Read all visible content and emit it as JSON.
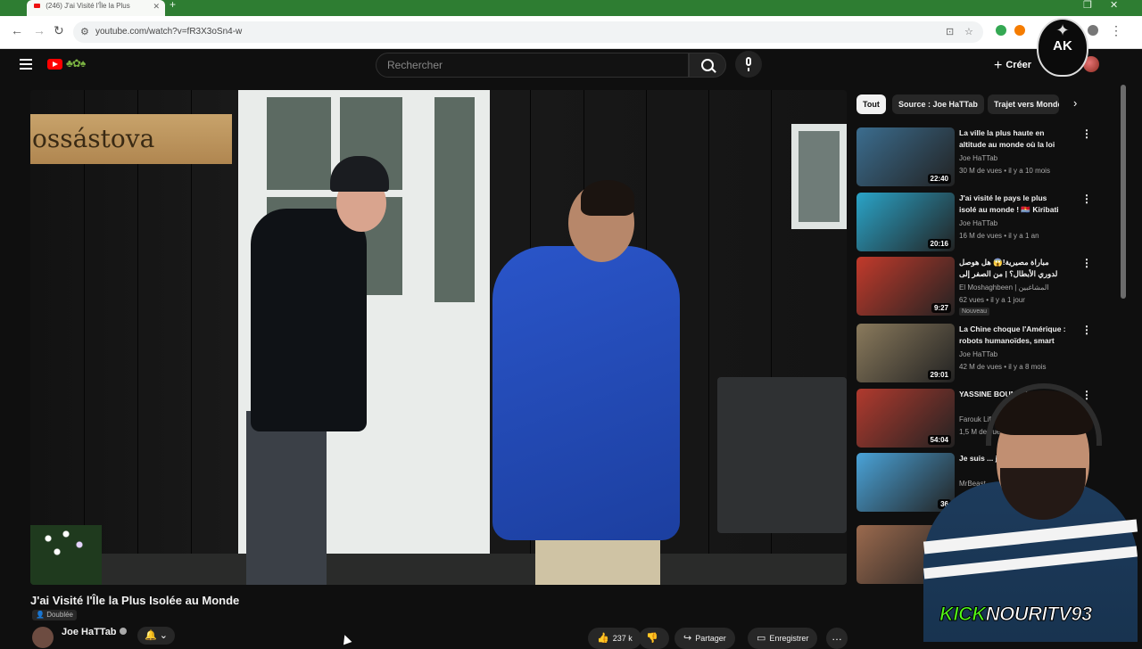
{
  "browser": {
    "tab_title": "(246) J'ai Visité l'Île la Plus",
    "url": "youtube.com/watch?v=fR3X3oSn4-w"
  },
  "overlay": {
    "logo_text": "AK",
    "kick_brand": "KICK",
    "kick_channel": "NOURITV93"
  },
  "header": {
    "search_placeholder": "Rechercher",
    "create_label": "Créer"
  },
  "video": {
    "sign_text": "ossástova",
    "title": "J'ai Visité l'Île la Plus Isolée au Monde",
    "dubbed_label": "Doublée",
    "channel": "Joe HaTTab",
    "likes": "237 k",
    "share_label": "Partager",
    "save_label": "Enregistrer"
  },
  "chips": [
    "Tout",
    "Source : Joe HaTTab",
    "Trajet vers Monde"
  ],
  "recommendations": [
    {
      "title": "La ville la plus haute en altitude au monde où la loi n'existe pas...",
      "channel": "Joe HaTTab",
      "meta": "30 M de vues • il y a 10 mois",
      "duration": "22:40",
      "thumb_color": "#3b6d8f"
    },
    {
      "title": "J'ai visité le pays le plus isolé au monde ! 🇰🇮 Kiribati",
      "channel": "Joe HaTTab",
      "meta": "16 M de vues • il y a 1 an",
      "duration": "20:16",
      "thumb_color": "#2aa4c8"
    },
    {
      "title": "مباراة مصيرية!😱 هل هوصل لدوري الأبطال؟ | من الصفر إلى القمة | الحلقة ...",
      "channel": "El Moshaghbeen | المشاغبين",
      "meta": "62 vues • il y a 1 jour",
      "duration": "9:27",
      "badge": "Nouveau",
      "thumb_color": "#c23a2b"
    },
    {
      "title": "La Chine choque l'Amérique : robots humanoïdes, smart citi...",
      "channel": "Joe HaTTab",
      "meta": "42 M de vues • il y a 8 mois",
      "duration": "29:01",
      "thumb_color": "#8a7a5c"
    },
    {
      "title": "YASSINE BOUNOU",
      "channel": "Farouk Life",
      "meta": "1,5 M de vues",
      "duration": "54:04",
      "thumb_color": "#b13a2e"
    },
    {
      "title": "Je suis ... jusqu'à ...",
      "channel": "MrBeast",
      "meta": "",
      "duration": "36",
      "thumb_color": "#4aa3d8"
    },
    {
      "title": "",
      "channel": "",
      "meta": "",
      "duration": "",
      "thumb_color": "#9b6a4e"
    }
  ]
}
